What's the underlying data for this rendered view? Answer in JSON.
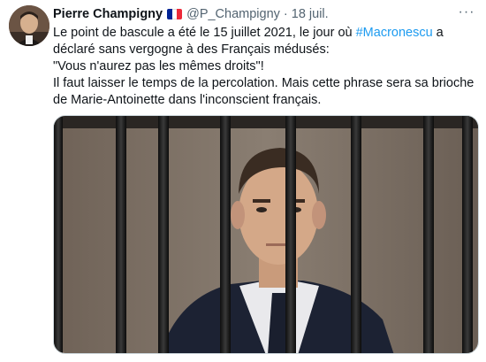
{
  "tweet": {
    "author_name": "Pierre Champigny",
    "handle": "@P_Champigny",
    "separator": "·",
    "date": "18 juil.",
    "more_label": "···",
    "flag_colors": [
      "#002395",
      "#ffffff",
      "#ed2939"
    ],
    "accent_color": "#1d9bf0",
    "text_line1_a": "Le point de bascule a été le 15 juillet 2021, le jour où ",
    "hashtag": "#Macronescu",
    "text_line1_b": " a déclaré sans vergogne à des Français médusés:",
    "text_line2": "\"Vous n'aurez pas les mêmes droits\"!",
    "text_line3": "Il faut laisser le temps de la percolation. Mais cette phrase sera sa brioche de Marie-Antoinette dans l'inconscient français."
  }
}
